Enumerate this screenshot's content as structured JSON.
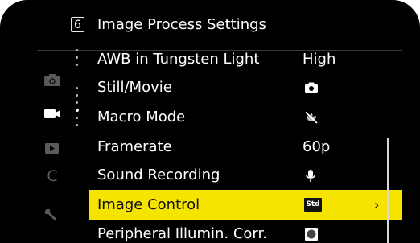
{
  "header": {
    "page_number": "6",
    "title": "Image Process Settings"
  },
  "sidebar": {
    "tabs": [
      {
        "icon": "camera-icon"
      },
      {
        "icon": "video-camera-icon",
        "active": true
      },
      {
        "icon": "playback-icon"
      },
      {
        "icon": "custom-c-icon",
        "label": "C"
      },
      {
        "icon": "wrench-icon"
      }
    ]
  },
  "menu": {
    "items": [
      {
        "label": "AWB in Tungsten Light",
        "value": "High"
      },
      {
        "label": "Still/Movie",
        "value_icon": "camera-icon"
      },
      {
        "label": "Macro Mode",
        "value_icon": "macro-off-icon"
      },
      {
        "label": "Framerate",
        "value": "60p"
      },
      {
        "label": "Sound Recording",
        "value_icon": "microphone-icon"
      },
      {
        "label": "Image Control",
        "value_badge": "Std",
        "selected": true,
        "chevron": "›"
      },
      {
        "label": "Peripheral Illumin. Corr.",
        "value_icon": "square-icon"
      }
    ]
  },
  "colors": {
    "highlight": "#f5e400",
    "background": "#000000",
    "text": "#ffffff"
  }
}
